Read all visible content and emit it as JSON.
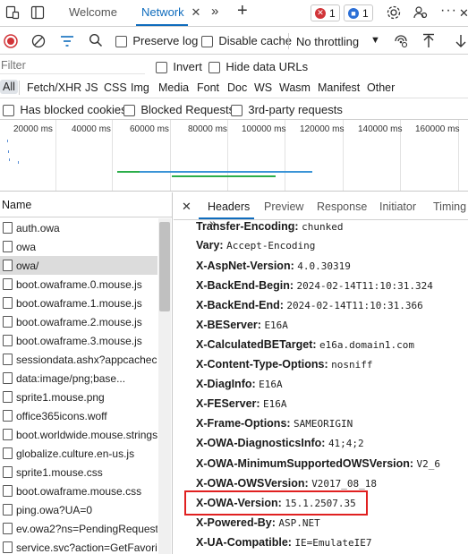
{
  "tabbar": {
    "tabs": [
      {
        "label": "Welcome"
      },
      {
        "label": "Network"
      }
    ],
    "errors_count": "1",
    "issues_count": "1"
  },
  "toolbar": {
    "preserve_log_label": "Preserve log",
    "disable_cache_label": "Disable cache",
    "throttling_value": "No throttling"
  },
  "filter": {
    "placeholder": "Filter",
    "invert_label": "Invert",
    "hide_data_urls_label": "Hide data URLs"
  },
  "types": [
    "All",
    "Fetch/XHR",
    "JS",
    "CSS",
    "Img",
    "Media",
    "Font",
    "Doc",
    "WS",
    "Wasm",
    "Manifest",
    "Other"
  ],
  "blocked": {
    "has_blocked_cookies_label": "Has blocked cookies",
    "blocked_requests_label": "Blocked Requests",
    "third_party_label": "3rd-party requests"
  },
  "overview": {
    "ticks": [
      "20000 ms",
      "40000 ms",
      "60000 ms",
      "80000 ms",
      "100000 ms",
      "120000 ms",
      "140000 ms",
      "160000 ms"
    ]
  },
  "requests": {
    "name_header": "Name",
    "rows": [
      "auth.owa",
      "owa",
      "owa/",
      "boot.owaframe.0.mouse.js",
      "boot.owaframe.1.mouse.js",
      "boot.owaframe.2.mouse.js",
      "boot.owaframe.3.mouse.js",
      "sessiondata.ashx?appcachecli",
      "data:image/png;base...",
      "sprite1.mouse.png",
      "office365icons.woff",
      "boot.worldwide.mouse.strings",
      "globalize.culture.en-us.js",
      "sprite1.mouse.css",
      "boot.owaframe.mouse.css",
      "ping.owa?UA=0",
      "ev.owa2?ns=PendingRequest.",
      "service.svc?action=GetFavorit"
    ]
  },
  "details": {
    "tabs": [
      "Headers",
      "Preview",
      "Response",
      "Initiator",
      "Timing"
    ],
    "headers": [
      {
        "key": "Transfer-Encoding:",
        "value": "chunked"
      },
      {
        "key": "Vary:",
        "value": "Accept-Encoding"
      },
      {
        "key": "X-AspNet-Version:",
        "value": "4.0.30319"
      },
      {
        "key": "X-BackEnd-Begin:",
        "value": "2024-02-14T11:10:31.324"
      },
      {
        "key": "X-BackEnd-End:",
        "value": "2024-02-14T11:10:31.366"
      },
      {
        "key": "X-BEServer:",
        "value": "E16A"
      },
      {
        "key": "X-CalculatedBETarget:",
        "value": "e16a.domain1.com"
      },
      {
        "key": "X-Content-Type-Options:",
        "value": "nosniff"
      },
      {
        "key": "X-DiagInfo:",
        "value": "E16A"
      },
      {
        "key": "X-FEServer:",
        "value": "E16A"
      },
      {
        "key": "X-Frame-Options:",
        "value": "SAMEORIGIN"
      },
      {
        "key": "X-OWA-DiagnosticsInfo:",
        "value": "41;4;2"
      },
      {
        "key": "X-OWA-MinimumSupportedOWSVersion:",
        "value": "V2_6"
      },
      {
        "key": "X-OWA-OWSVersion:",
        "value": "V2017_08_18"
      },
      {
        "key": "X-OWA-Version:",
        "value": "15.1.2507.35"
      },
      {
        "key": "X-Powered-By:",
        "value": "ASP.NET"
      },
      {
        "key": "X-UA-Compatible:",
        "value": "IE=EmulateIE7"
      }
    ]
  },
  "colors": {
    "accent": "#0f6cbd",
    "error_red": "#d13438",
    "highlight_box": "#e02020"
  }
}
